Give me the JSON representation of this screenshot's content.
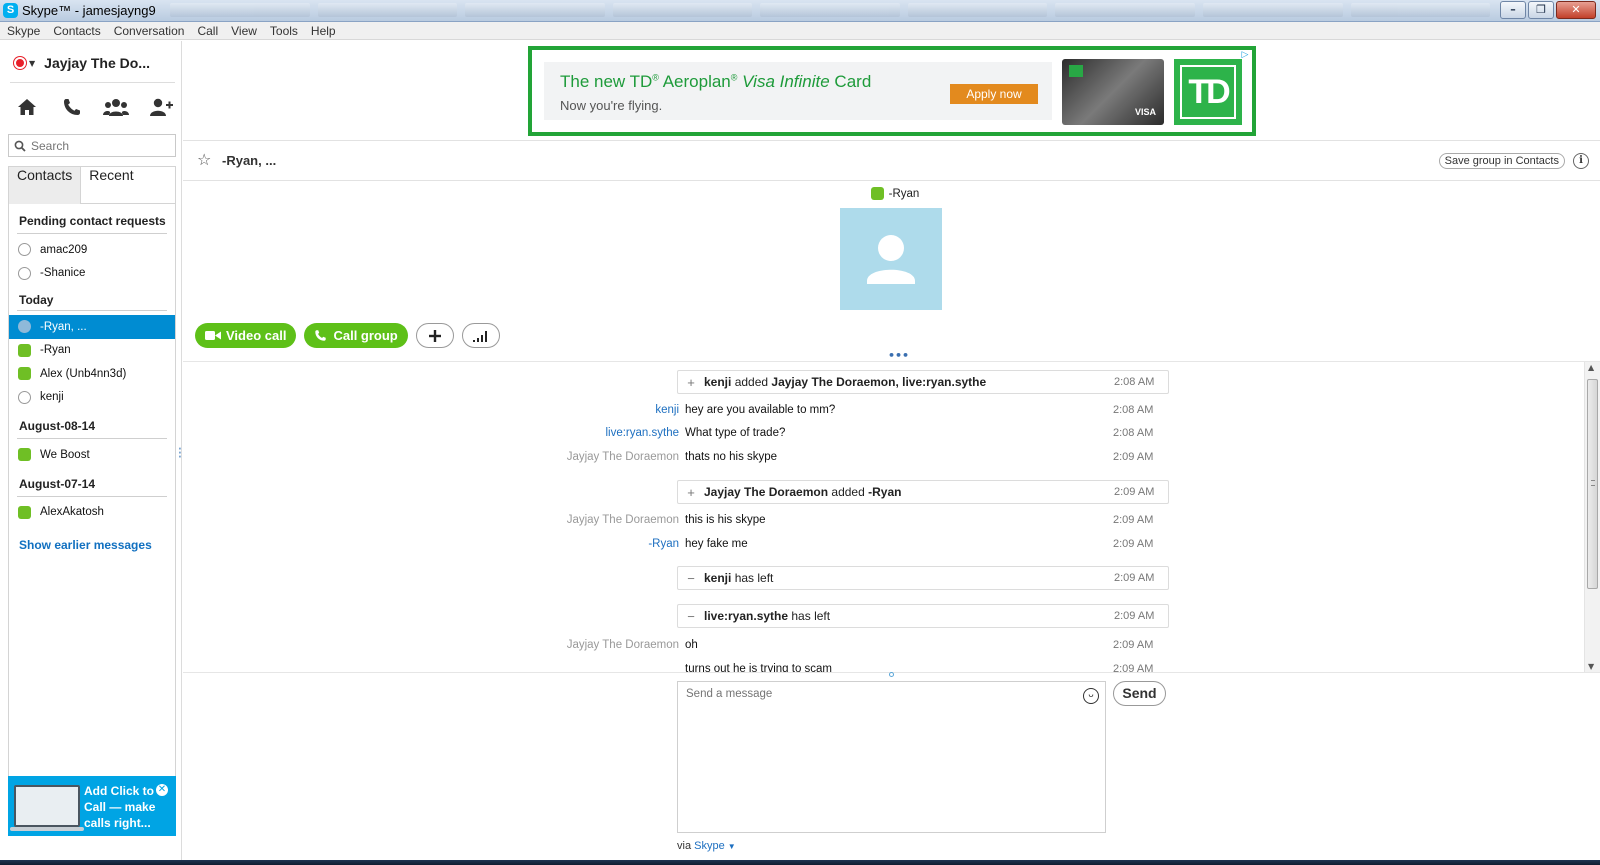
{
  "window": {
    "title": "Skype™ - jamesjayng9"
  },
  "menu": [
    "Skype",
    "Contacts",
    "Conversation",
    "Call",
    "View",
    "Tools",
    "Help"
  ],
  "profile": {
    "name": "Jayjay The Do..."
  },
  "search": {
    "placeholder": "Search"
  },
  "tabs": {
    "contacts": "Contacts",
    "recent": "Recent"
  },
  "groups": {
    "pending": "Pending contact requests",
    "today": "Today",
    "aug14": "August-08-14",
    "aug07": "August-07-14"
  },
  "contacts": {
    "pending": [
      "amac209",
      "-Shanice"
    ],
    "today": [
      "-Ryan, ...",
      "-Ryan",
      "Alex (Unb4nn3d)",
      "kenji"
    ],
    "aug14": [
      "We Boost"
    ],
    "aug07": [
      "AlexAkatosh"
    ]
  },
  "show_earlier": "Show earlier messages",
  "promo": {
    "text": "Add Click to Call — make calls right..."
  },
  "ad": {
    "headline_1": "The new TD",
    "headline_reg": "®",
    "headline_2": " Aeroplan",
    "headline_reg2": "®",
    "headline_visa": " Visa Infinite",
    "headline_3": " Card",
    "sub": "Now you're flying.",
    "cta": "Apply now",
    "logo": "TD",
    "card_brand": "VISA",
    "brand_color": "#2db34a"
  },
  "conversation": {
    "title": "-Ryan, ...",
    "save_group": "Save group in Contacts",
    "participant": "-Ryan",
    "video_call": "Video call",
    "call_group": "Call group"
  },
  "messages": [
    {
      "kind": "system",
      "sign": "+",
      "actor": "kenji",
      "verb": " added ",
      "target": "Jayjay The Doraemon, live:ryan.sythe",
      "time": "2:08 AM"
    },
    {
      "kind": "msg",
      "sender": "kenji",
      "sender_style": "blue",
      "text": "hey are you available to mm?",
      "time": "2:08 AM"
    },
    {
      "kind": "msg",
      "sender": "live:ryan.sythe",
      "sender_style": "blue",
      "text": "What type of trade?",
      "time": "2:08 AM"
    },
    {
      "kind": "msg",
      "sender": "Jayjay The Doraemon",
      "sender_style": "grey",
      "text": "thats no his skype",
      "time": "2:09 AM"
    },
    {
      "kind": "system",
      "sign": "+",
      "actor": "Jayjay The Doraemon",
      "verb": " added ",
      "target": "-Ryan",
      "time": "2:09 AM"
    },
    {
      "kind": "msg",
      "sender": "Jayjay The Doraemon",
      "sender_style": "grey",
      "text": "this is his skype",
      "time": "2:09 AM"
    },
    {
      "kind": "msg",
      "sender": "-Ryan",
      "sender_style": "blue",
      "text": "hey fake me",
      "time": "2:09 AM"
    },
    {
      "kind": "system",
      "sign": "−",
      "actor": "kenji",
      "verb": " has left",
      "target": "",
      "time": "2:09 AM"
    },
    {
      "kind": "system",
      "sign": "−",
      "actor": "live:ryan.sythe",
      "verb": " has left",
      "target": "",
      "time": "2:09 AM"
    },
    {
      "kind": "msg",
      "sender": "Jayjay The Doraemon",
      "sender_style": "grey",
      "text": "oh",
      "time": "2:09 AM"
    },
    {
      "kind": "msg",
      "sender": "",
      "sender_style": "grey",
      "text": "turns out he is trying to scam",
      "time": "2:09 AM"
    }
  ],
  "composer": {
    "placeholder": "Send a message",
    "send": "Send",
    "via_label": "via ",
    "via_service": "Skype"
  },
  "colors": {
    "accent": "#00aff0",
    "selected": "#008cd2",
    "online": "#6fbf25",
    "call_green": "#5ec018",
    "link": "#1d6fc0"
  }
}
